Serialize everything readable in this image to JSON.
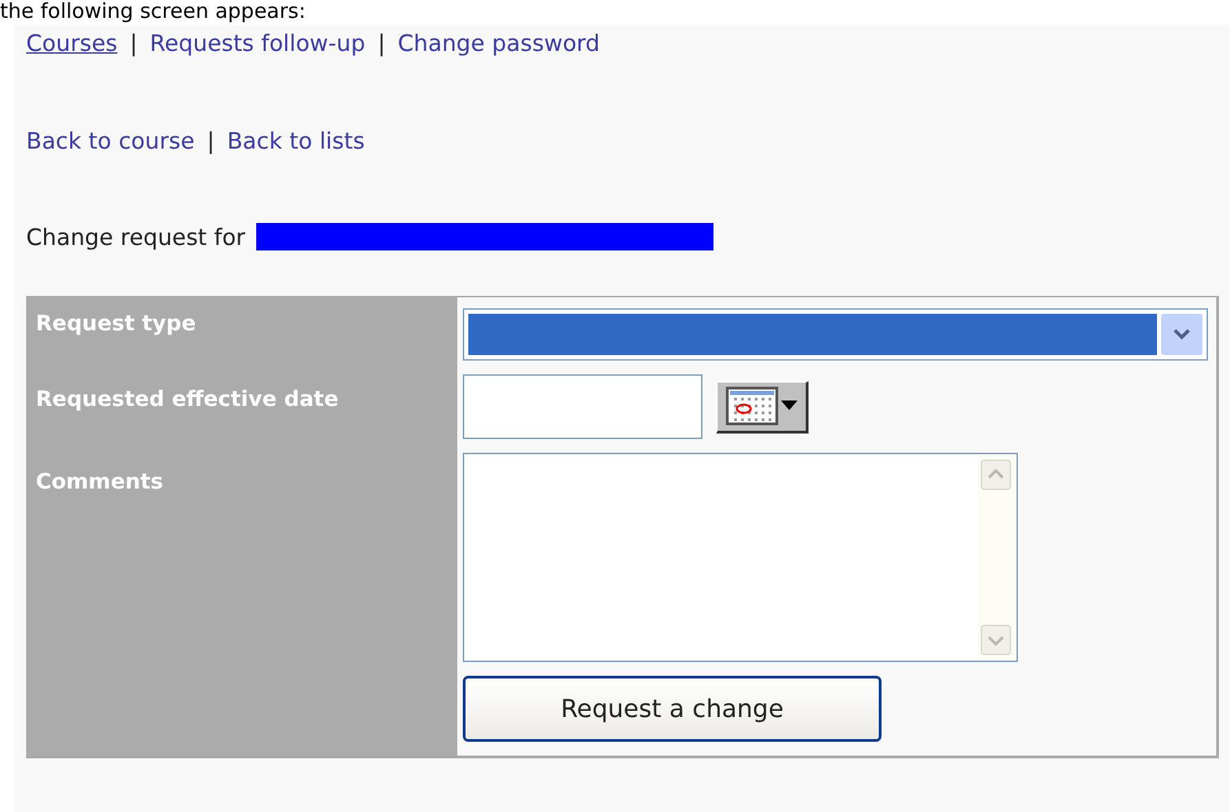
{
  "intro_text": "the following screen appears:",
  "top_nav": {
    "separator": "|",
    "links": [
      {
        "label": "Courses",
        "selected": true
      },
      {
        "label": "Requests follow-up",
        "selected": false
      },
      {
        "label": "Change password",
        "selected": false
      }
    ]
  },
  "back_nav": {
    "separator": "|",
    "links": [
      {
        "label": "Back to course",
        "selected": false
      },
      {
        "label": "Back to lists",
        "selected": false
      }
    ]
  },
  "heading": "Change request for",
  "form": {
    "fields": [
      {
        "kind": "select",
        "label": "Request type"
      },
      {
        "kind": "date",
        "label": "Requested effective date"
      },
      {
        "kind": "textarea",
        "label": "Comments"
      }
    ],
    "submit": "Request a change"
  }
}
